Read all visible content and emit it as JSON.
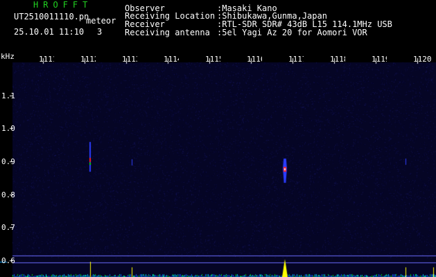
{
  "header": {
    "app_name": "HROFFT",
    "file_name": "UT2510011110.pn",
    "mode": "meteor",
    "date_time": "25.10.01 11:10",
    "minute_index": "3",
    "observer_label": "Observer",
    "observer_value": ":Masaki Kano",
    "location_label": "Receiving Location",
    "location_value": ":Shibukawa,Gunma,Japan",
    "receiver_label": "Receiver",
    "receiver_value": ":RTL-SDR SDR# 43dB L15 114.1MHz USB",
    "antenna_label": "Receiving antenna",
    "antenna_value": ":5el Yagi Az 20 for Aomori VOR"
  },
  "chart_data": {
    "type": "heatmap",
    "title": "",
    "ylabel": "kHz",
    "ylim": [
      0.55,
      1.2
    ],
    "y_ticks": [
      "1.1",
      "1.0",
      "0.9",
      "0.8",
      "0.7",
      "0.6"
    ],
    "y_tick_values": [
      1.1,
      1.0,
      0.9,
      0.8,
      0.7,
      0.6
    ],
    "x_ticks": [
      "1111",
      "1112",
      "1113",
      "1114",
      "1115",
      "1116",
      "1117",
      "1118",
      "1119",
      "1120"
    ],
    "echoes": [
      {
        "time_index": 1112,
        "freq_khz": 0.905,
        "strength": "medium",
        "colors": [
          "#2b3dff",
          "#ff2020",
          "#00e000"
        ]
      },
      {
        "time_index": 1113,
        "freq_khz": 0.898,
        "strength": "weak",
        "colors": [
          "#3040ff"
        ]
      },
      {
        "time_index": 1117,
        "freq_khz": 0.88,
        "strength": "strong",
        "colors": [
          "#2b3dff",
          "#ff2020",
          "#e0e0ff"
        ]
      },
      {
        "time_index": 1120,
        "freq_khz": 0.9,
        "strength": "weak",
        "colors": [
          "#3040ff"
        ]
      }
    ],
    "background_color": "#050525",
    "accent_colors": {
      "yellow": "#ffff00",
      "cyan": "#00c8ff",
      "green": "#21d321"
    }
  }
}
